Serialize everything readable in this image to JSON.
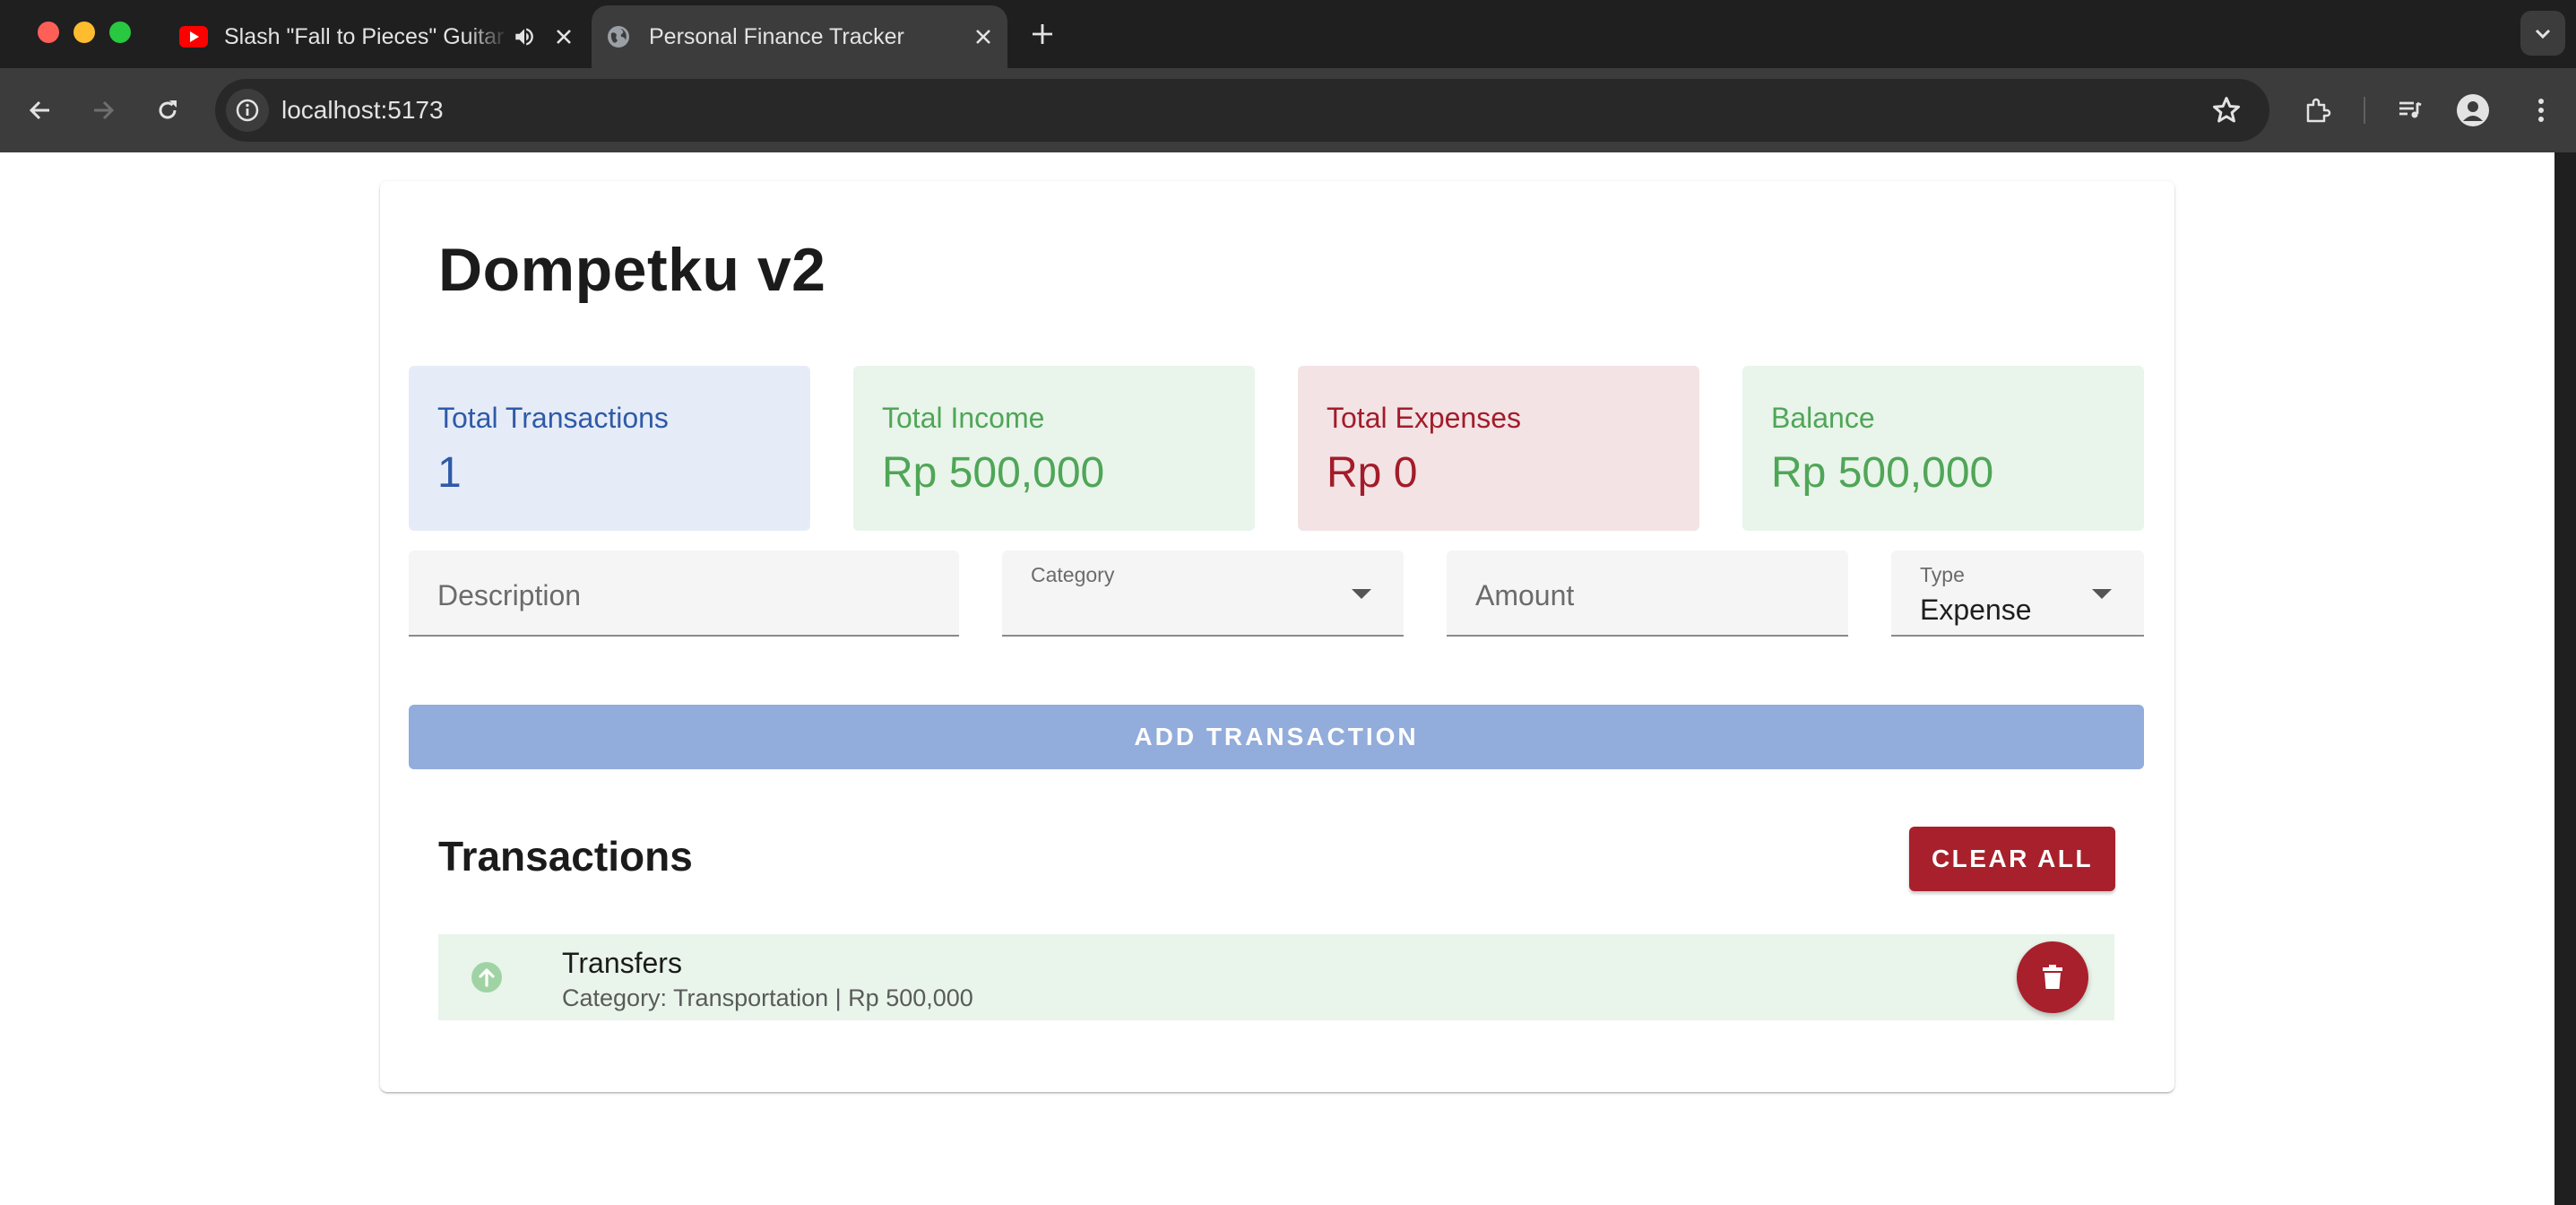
{
  "browser": {
    "tabs": [
      {
        "title": "Slash \"Fall to Pieces\" Guitar Solo",
        "favicon": "youtube-icon",
        "audio": "speaker-icon"
      },
      {
        "title": "Personal Finance Tracker",
        "favicon": "globe-icon"
      }
    ],
    "url": "localhost:5173"
  },
  "app": {
    "title": "Dompetku v2",
    "stats": [
      {
        "label": "Total Transactions",
        "value": "1",
        "color": "#2f5aa8"
      },
      {
        "label": "Total Income",
        "value": "Rp 500,000",
        "color": "#4fa657"
      },
      {
        "label": "Total Expenses",
        "value": "Rp 0",
        "color": "#a31c2a"
      },
      {
        "label": "Balance",
        "value": "Rp 500,000",
        "color": "#4fa657"
      }
    ],
    "form": {
      "description_placeholder": "Description",
      "category_label": "Category",
      "category_value": "",
      "amount_placeholder": "Amount",
      "type_label": "Type",
      "type_value": "Expense",
      "add_button": "ADD TRANSACTION"
    },
    "transactions_title": "Transactions",
    "clear_all_button": "CLEAR ALL",
    "transactions": [
      {
        "title": "Transfers",
        "subtitle": "Category: Transportation | Rp 500,000",
        "type": "income",
        "icon": "arrow-up-circle-icon"
      }
    ]
  },
  "colors": {
    "primary": "#92acdb",
    "danger": "#a8202b",
    "income": "#4fa657"
  }
}
